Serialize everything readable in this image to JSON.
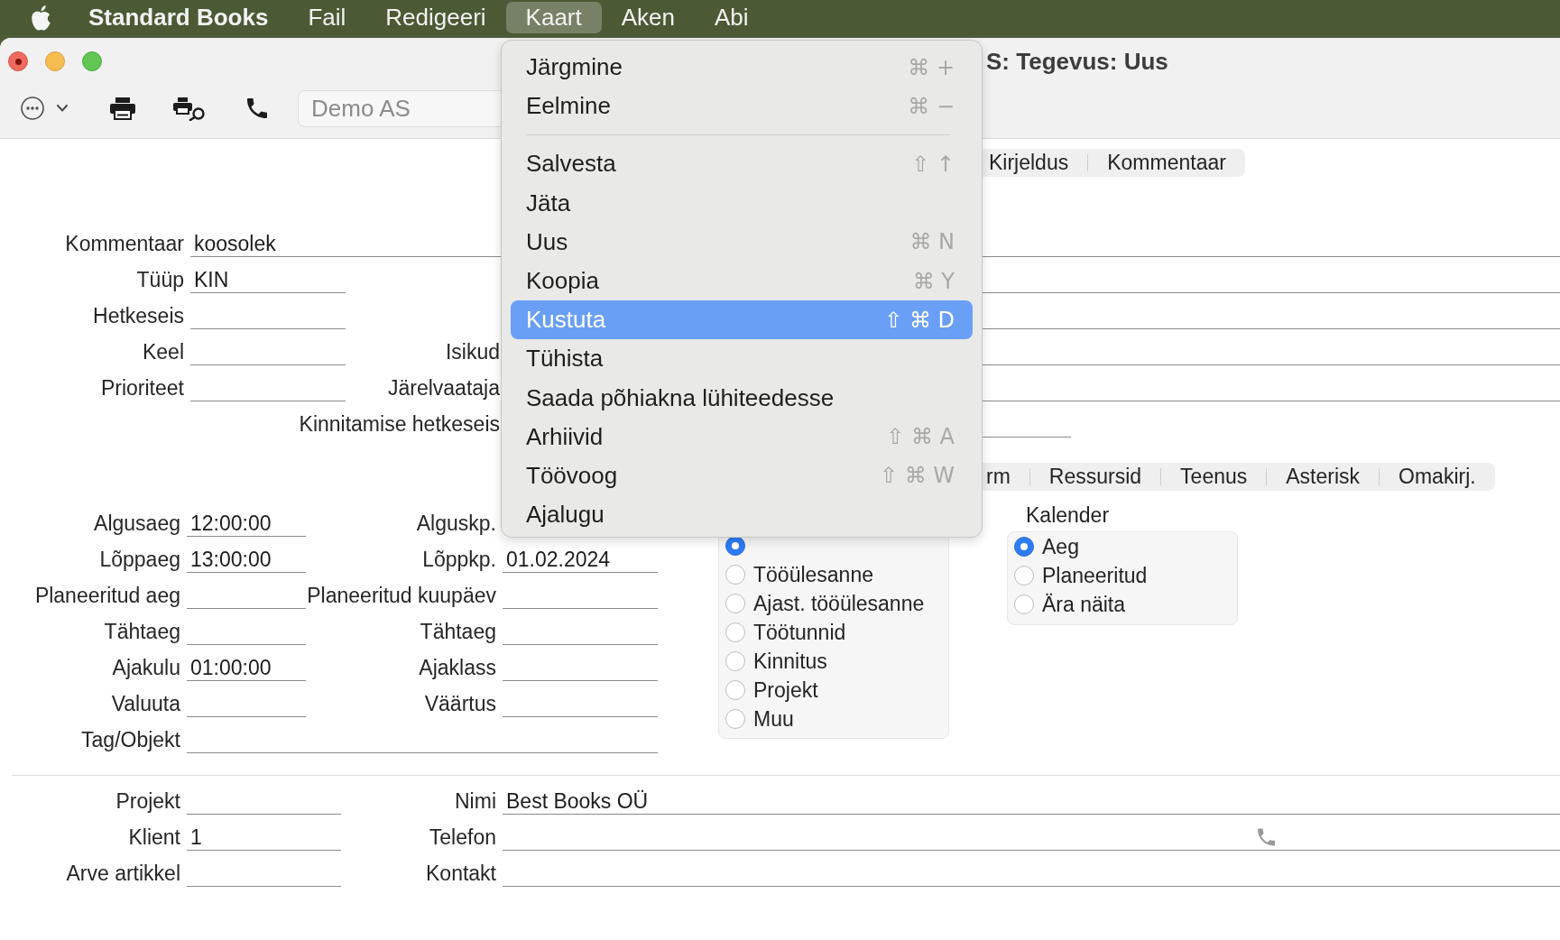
{
  "menubar": [
    {
      "label": "Standard Books",
      "kind": "app",
      "selected": false
    },
    {
      "label": "Fail",
      "kind": "menu",
      "selected": false
    },
    {
      "label": "Redigeeri",
      "kind": "menu",
      "selected": false
    },
    {
      "label": "Kaart",
      "kind": "menu",
      "selected": true
    },
    {
      "label": "Aken",
      "kind": "menu",
      "selected": false
    },
    {
      "label": "Abi",
      "kind": "menu",
      "selected": false
    }
  ],
  "window": {
    "title": "S: Tegevus: Uus",
    "edited": true
  },
  "toolbar": {
    "company_field": {
      "placeholder": "Demo AS"
    }
  },
  "top_tabs": [
    {
      "label": "Kirjeldus",
      "selected": false
    },
    {
      "label": "Kommentaar",
      "selected": false
    }
  ],
  "header_form": [
    {
      "kind": "wide",
      "left": {
        "label": "Kommentaar",
        "value": "koosolek"
      }
    },
    {
      "kind": "pair",
      "left": {
        "label": "Tüüp",
        "value": "KIN"
      },
      "right": {
        "kind": "long"
      }
    },
    {
      "kind": "pair",
      "left": {
        "label": "Hetkeseis"
      },
      "right": {
        "kind": "long"
      }
    },
    {
      "kind": "pair",
      "left": {
        "label": "Keel"
      },
      "right": {
        "label": "Isikud",
        "kind": "long"
      }
    },
    {
      "kind": "pair",
      "left": {
        "label": "Prioriteet"
      },
      "right": {
        "label": "Järelvaataja",
        "kind": "long"
      }
    },
    {
      "kind": "right",
      "right": {
        "label": "Kinnitamise hetkeseis",
        "kind": "short"
      }
    }
  ],
  "lower_tabs": [
    {
      "label": "rm",
      "selected": false
    },
    {
      "label": "Ressursid",
      "selected": false
    },
    {
      "label": "Teenus",
      "selected": false
    },
    {
      "label": "Asterisk",
      "selected": false
    },
    {
      "label": "Omakirj.",
      "selected": false
    }
  ],
  "time_form": [
    {
      "kind": "pair",
      "left": {
        "label": "Algusaeg",
        "value": "12:00:00"
      },
      "right": {
        "label": "Alguskp.",
        "kind": "label"
      }
    },
    {
      "kind": "pair",
      "left": {
        "label": "Lõppaeg",
        "value": "13:00:00"
      },
      "right": {
        "label": "Lõppkp.",
        "value": "01.02.2024",
        "kind": "field"
      }
    },
    {
      "kind": "pair",
      "left": {
        "label": "Planeeritud aeg"
      },
      "right": {
        "label": "Planeeritud kuupäev",
        "kind": "field"
      }
    },
    {
      "kind": "pair",
      "left": {
        "label": "Tähtaeg"
      },
      "right": {
        "label": "Tähtaeg",
        "kind": "field"
      }
    },
    {
      "kind": "pair",
      "left": {
        "label": "Ajakulu",
        "value": "01:00:00"
      },
      "right": {
        "label": "Ajaklass",
        "kind": "field"
      }
    },
    {
      "kind": "pair",
      "left": {
        "label": "Valuuta"
      },
      "right": {
        "label": "Väärtus",
        "kind": "field"
      }
    },
    {
      "kind": "wide",
      "left": {
        "label": "Tag/Objekt"
      }
    }
  ],
  "activity_type": {
    "options": [
      {
        "selected": true
      },
      {
        "label": "Tööülesanne",
        "selected": false
      },
      {
        "label": "Ajast. tööülesanne",
        "selected": false
      },
      {
        "label": "Töötunnid",
        "selected": false
      },
      {
        "label": "Kinnitus",
        "selected": false
      },
      {
        "label": "Projekt",
        "selected": false
      },
      {
        "label": "Muu",
        "selected": false
      }
    ]
  },
  "calendar": {
    "title": "Kalender",
    "options": [
      {
        "label": "Aeg",
        "selected": true
      },
      {
        "label": "Planeeritud",
        "selected": false
      },
      {
        "label": "Ära näita",
        "selected": false
      }
    ]
  },
  "footer_form": [
    {
      "left": {
        "label": "Projekt"
      },
      "right": {
        "label": "Nimi",
        "value": "Best Books OÜ",
        "kind": "field"
      }
    },
    {
      "left": {
        "label": "Klient",
        "value": "1"
      },
      "right": {
        "label": "Telefon",
        "kind": "phone"
      }
    },
    {
      "left": {
        "label": "Arve artikkel"
      },
      "right": {
        "label": "Kontakt",
        "kind": "field"
      }
    }
  ],
  "menu": {
    "items": [
      {
        "kind": "item",
        "label": "Järgmine",
        "shortcut": "⌘ +",
        "selected": false
      },
      {
        "kind": "item",
        "label": "Eelmine",
        "shortcut": "⌘ −",
        "selected": false
      },
      {
        "kind": "separator"
      },
      {
        "kind": "item",
        "label": "Salvesta",
        "shortcut": "⇧ ↑",
        "selected": false
      },
      {
        "kind": "item",
        "label": "Jäta",
        "selected": false
      },
      {
        "kind": "item",
        "label": "Uus",
        "shortcut": "⌘ N",
        "selected": false
      },
      {
        "kind": "item",
        "label": "Koopia",
        "shortcut": "⌘ Y",
        "selected": false
      },
      {
        "kind": "item",
        "label": "Kustuta",
        "shortcut": "⇧ ⌘ D",
        "selected": true
      },
      {
        "kind": "item",
        "label": "Tühista",
        "selected": false
      },
      {
        "kind": "item",
        "label": "Saada põhiakna lühiteedesse",
        "selected": false
      },
      {
        "kind": "item",
        "label": "Arhiivid",
        "shortcut": "⇧ ⌘ A",
        "selected": false
      },
      {
        "kind": "item",
        "label": "Töövoog",
        "shortcut": "⇧ ⌘ W",
        "selected": false
      },
      {
        "kind": "item",
        "label": "Ajalugu",
        "selected": false
      }
    ]
  }
}
